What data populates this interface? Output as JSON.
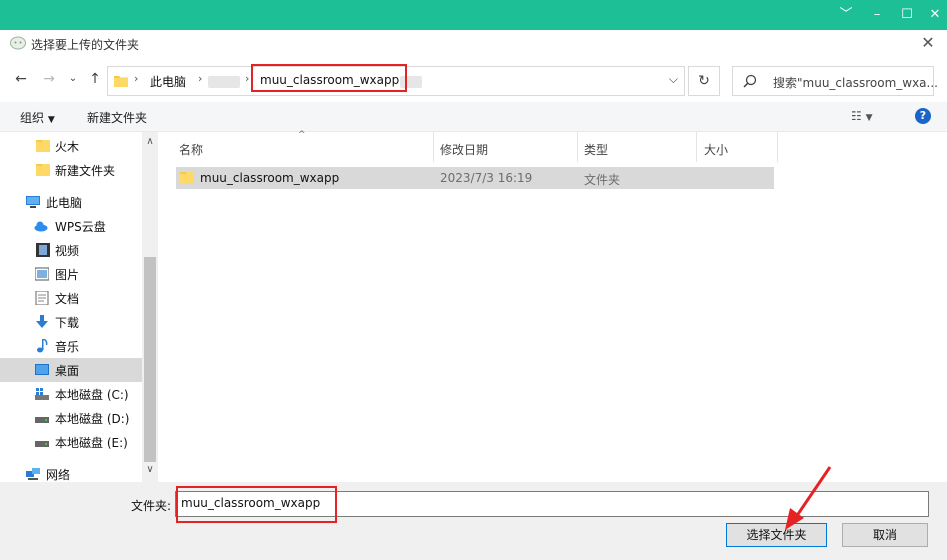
{
  "dialog": {
    "title": "选择要上传的文件夹"
  },
  "window_controls": {
    "minimize": "–",
    "maximize": "☐",
    "close": "✕",
    "collapse": "﹀"
  },
  "address": {
    "root_crumb": "此电脑",
    "current_folder": "muu_classroom_wxapp"
  },
  "search": {
    "placeholder": "搜索\"muu_classroom_wxa..."
  },
  "toolbar": {
    "organize_label": "组织",
    "new_folder_label": "新建文件夹"
  },
  "sidebar": {
    "items": [
      {
        "label": "火木",
        "icon": "folder-icon"
      },
      {
        "label": "新建文件夹",
        "icon": "folder-icon"
      },
      {
        "label": "此电脑",
        "icon": "computer-icon"
      },
      {
        "label": "WPS云盘",
        "icon": "cloud-icon"
      },
      {
        "label": "视频",
        "icon": "video-icon"
      },
      {
        "label": "图片",
        "icon": "picture-icon"
      },
      {
        "label": "文档",
        "icon": "document-icon"
      },
      {
        "label": "下载",
        "icon": "download-icon"
      },
      {
        "label": "音乐",
        "icon": "music-icon"
      },
      {
        "label": "桌面",
        "icon": "desktop-icon"
      },
      {
        "label": "本地磁盘 (C:)",
        "icon": "system-drive-icon"
      },
      {
        "label": "本地磁盘 (D:)",
        "icon": "drive-icon"
      },
      {
        "label": "本地磁盘 (E:)",
        "icon": "drive-icon"
      },
      {
        "label": "网络",
        "icon": "network-icon"
      }
    ]
  },
  "file_list": {
    "columns": [
      "名称",
      "修改日期",
      "类型",
      "大小"
    ],
    "rows": [
      {
        "name": "muu_classroom_wxapp",
        "modified": "2023/7/3 16:19",
        "type": "文件夹",
        "size": ""
      }
    ]
  },
  "footer": {
    "folder_label": "文件夹:",
    "folder_value": "muu_classroom_wxapp",
    "select_button": "选择文件夹",
    "cancel_button": "取消"
  },
  "colors": {
    "title_bar": "#1dbf97",
    "annotation_red": "#e52323",
    "selection_gray": "#d9d9d9",
    "help_blue": "#1a66c8"
  }
}
